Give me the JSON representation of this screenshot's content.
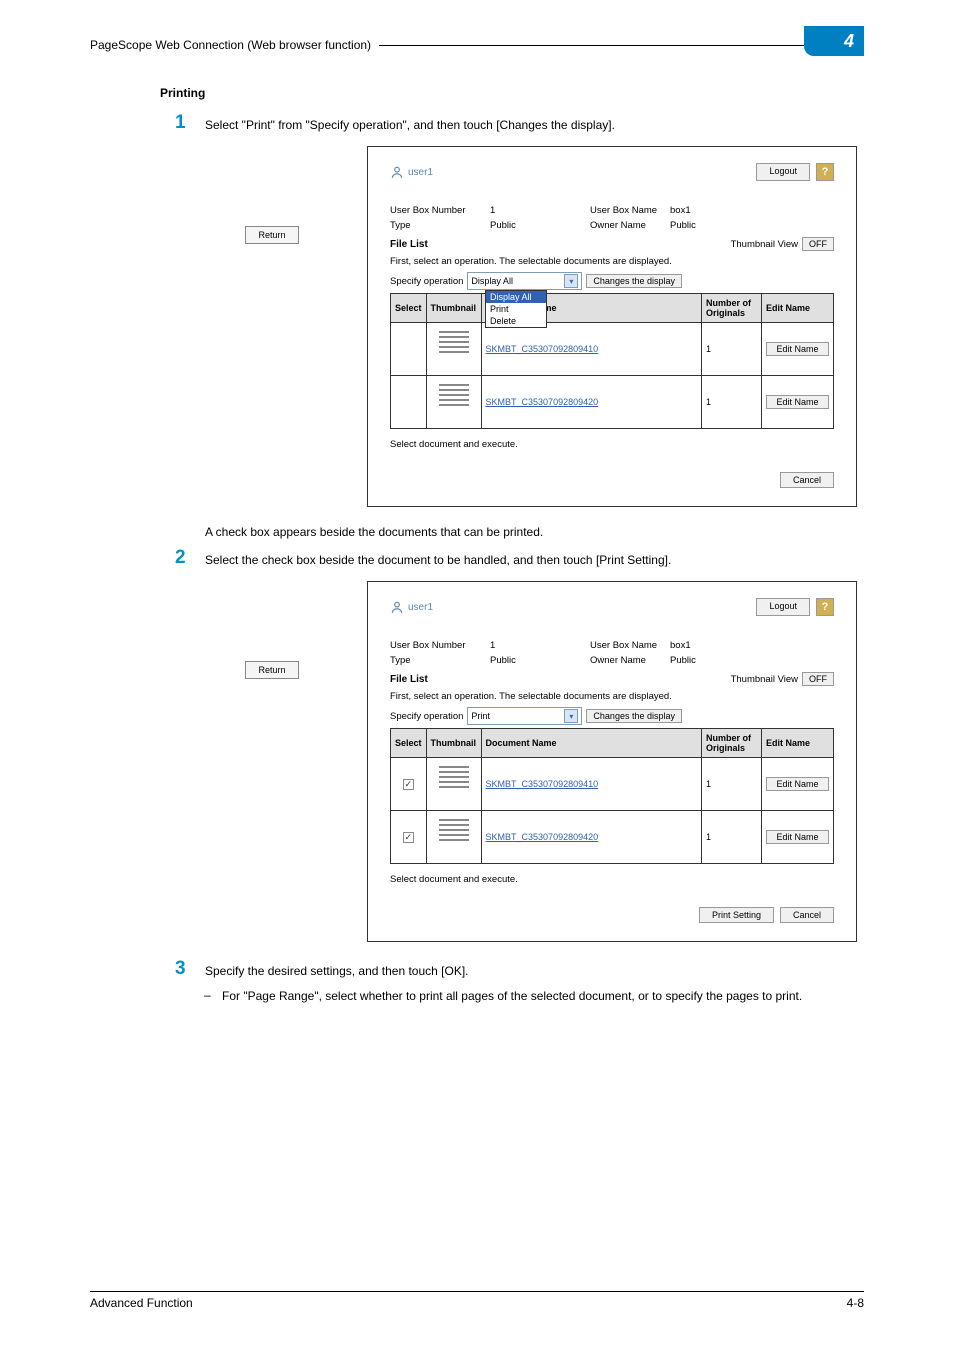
{
  "header": {
    "title": "PageScope Web Connection (Web browser function)"
  },
  "chapter": "4",
  "section_title": "Printing",
  "steps": {
    "s1_num": "1",
    "s1_text": "Select \"Print\" from \"Specify operation\", and then touch [Changes the display].",
    "mid_para": "A check box appears beside the documents that can be printed.",
    "s2_num": "2",
    "s2_text": "Select the check box beside the document to be handled, and then touch [Print Setting].",
    "s3_num": "3",
    "s3_text": "Specify the desired settings, and then touch [OK].",
    "s3_sub_dash": "–",
    "s3_sub_text": "For \"Page Range\", select whether to print all pages of the selected document, or to specify the pages to print."
  },
  "return_btn": "Return",
  "shotA": {
    "user": "user1",
    "logout": "Logout",
    "help": "?",
    "ubn_lbl": "User Box Number",
    "ubn_val": "1",
    "ubname_lbl": "User Box Name",
    "ubname_val": "box1",
    "type_lbl": "Type",
    "type_val": "Public",
    "owner_lbl": "Owner Name",
    "owner_val": "Public",
    "file_list": "File List",
    "thumb_view": "Thumbnail View",
    "off": "OFF",
    "hint": "First, select an operation. The selectable documents are displayed.",
    "spec_lbl": "Specify operation",
    "spec_val": "Display All",
    "changes": "Changes the display",
    "dropdown": {
      "o1": "Display All",
      "o2": "Print",
      "o3": "Delete"
    },
    "cols": {
      "select": "Select",
      "thumb": "Thumbnail",
      "name": "Document Name",
      "num": "Number of Originals",
      "edit": "Edit Name"
    },
    "rows": [
      {
        "name": "SKMBT_C35307092809410",
        "num": "1",
        "edit": "Edit Name"
      },
      {
        "name": "SKMBT_C35307092809420",
        "num": "1",
        "edit": "Edit Name"
      }
    ],
    "exec": "Select document and execute.",
    "cancel": "Cancel"
  },
  "shotB": {
    "user": "user1",
    "logout": "Logout",
    "help": "?",
    "ubn_lbl": "User Box Number",
    "ubn_val": "1",
    "ubname_lbl": "User Box Name",
    "ubname_val": "box1",
    "type_lbl": "Type",
    "type_val": "Public",
    "owner_lbl": "Owner Name",
    "owner_val": "Public",
    "file_list": "File List",
    "thumb_view": "Thumbnail View",
    "off": "OFF",
    "hint": "First, select an operation. The selectable documents are displayed.",
    "spec_lbl": "Specify operation",
    "spec_val": "Print",
    "changes": "Changes the display",
    "cols": {
      "select": "Select",
      "thumb": "Thumbnail",
      "name": "Document Name",
      "num": "Number of Originals",
      "edit": "Edit Name"
    },
    "rows": [
      {
        "name": "SKMBT_C35307092809410",
        "num": "1",
        "edit": "Edit Name"
      },
      {
        "name": "SKMBT_C35307092809420",
        "num": "1",
        "edit": "Edit Name"
      }
    ],
    "exec": "Select document and execute.",
    "print_setting": "Print Setting",
    "cancel": "Cancel"
  },
  "footer": {
    "left": "Advanced Function",
    "right": "4-8"
  }
}
